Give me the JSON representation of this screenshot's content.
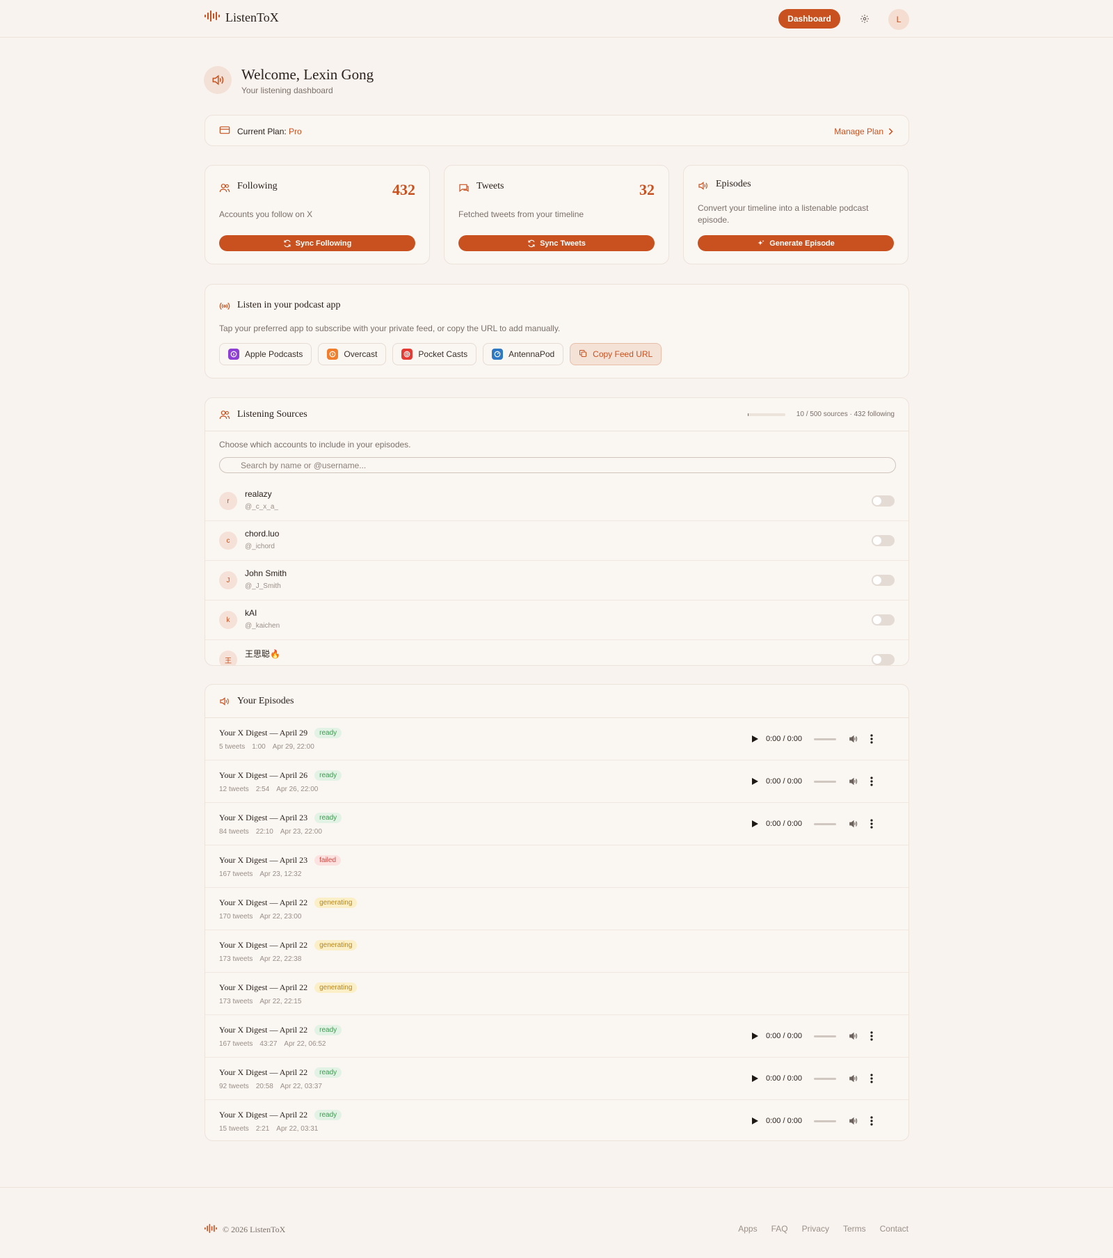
{
  "colors": {
    "accent": "#c8511f",
    "background": "#f8f3ee",
    "ready": "#3f9a52",
    "failed": "#d24b45",
    "generating": "#b6861d"
  },
  "header": {
    "brand": "ListenToX",
    "dashboard_label": "Dashboard",
    "avatar_initial": "L"
  },
  "welcome": {
    "title": "Welcome, Lexin Gong",
    "subtitle": "Your listening dashboard"
  },
  "plan": {
    "label": "Current Plan:",
    "value": "Pro",
    "manage_label": "Manage Plan"
  },
  "stats": [
    {
      "title": "Following",
      "number": "432",
      "description": "Accounts you follow on X",
      "button": "Sync Following"
    },
    {
      "title": "Tweets",
      "number": "32",
      "description": "Fetched tweets from your timeline",
      "button": "Sync Tweets"
    },
    {
      "title": "Episodes",
      "number": "",
      "description": "Convert your timeline into a listenable podcast episode.",
      "button": "Generate Episode"
    }
  ],
  "podcast": {
    "title": "Listen in your podcast app",
    "description": "Tap your preferred app to subscribe with your private feed, or copy the URL to add manually.",
    "apps": [
      "Apple Podcasts",
      "Overcast",
      "Pocket Casts",
      "AntennaPod"
    ],
    "copy_label": "Copy Feed URL"
  },
  "sources": {
    "title": "Listening Sources",
    "usage_fraction": 0.02,
    "count_text": "10 / 500 sources · 432 following",
    "description": "Choose which accounts to include in your episodes.",
    "search_placeholder": "Search by name or @username...",
    "items": [
      {
        "initial": "r",
        "name": "realazy",
        "handle": "@_c_x_a_",
        "enabled": false
      },
      {
        "initial": "c",
        "name": "chord.luo",
        "handle": "@_ichord",
        "enabled": false
      },
      {
        "initial": "J",
        "name": "John Smith",
        "handle": "@_J_Smith",
        "enabled": false
      },
      {
        "initial": "k",
        "name": "kAI",
        "handle": "@_kaichen",
        "enabled": false
      },
      {
        "initial": "王",
        "name": "王思聪🔥",
        "handle": "",
        "enabled": false
      }
    ]
  },
  "episodes": {
    "title": "Your Episodes",
    "player_time": "0:00 / 0:00",
    "items": [
      {
        "title": "Your X Digest — April 29",
        "status": "ready",
        "tweets": "5 tweets",
        "duration": "1:00",
        "date": "Apr 29, 22:00"
      },
      {
        "title": "Your X Digest — April 26",
        "status": "ready",
        "tweets": "12 tweets",
        "duration": "2:54",
        "date": "Apr 26, 22:00"
      },
      {
        "title": "Your X Digest — April 23",
        "status": "ready",
        "tweets": "84 tweets",
        "duration": "22:10",
        "date": "Apr 23, 22:00"
      },
      {
        "title": "Your X Digest — April 23",
        "status": "failed",
        "tweets": "167 tweets",
        "duration": "",
        "date": "Apr 23, 12:32"
      },
      {
        "title": "Your X Digest — April 22",
        "status": "generating",
        "tweets": "170 tweets",
        "duration": "",
        "date": "Apr 22, 23:00"
      },
      {
        "title": "Your X Digest — April 22",
        "status": "generating",
        "tweets": "173 tweets",
        "duration": "",
        "date": "Apr 22, 22:38"
      },
      {
        "title": "Your X Digest — April 22",
        "status": "generating",
        "tweets": "173 tweets",
        "duration": "",
        "date": "Apr 22, 22:15"
      },
      {
        "title": "Your X Digest — April 22",
        "status": "ready",
        "tweets": "167 tweets",
        "duration": "43:27",
        "date": "Apr 22, 06:52"
      },
      {
        "title": "Your X Digest — April 22",
        "status": "ready",
        "tweets": "92 tweets",
        "duration": "20:58",
        "date": "Apr 22, 03:37"
      },
      {
        "title": "Your X Digest — April 22",
        "status": "ready",
        "tweets": "15 tweets",
        "duration": "2:21",
        "date": "Apr 22, 03:31"
      }
    ]
  },
  "footer": {
    "copyright": "© 2026 ListenToX",
    "links": [
      "Apps",
      "FAQ",
      "Privacy",
      "Terms",
      "Contact"
    ]
  }
}
